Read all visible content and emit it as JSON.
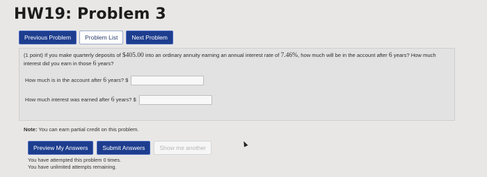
{
  "page": {
    "title": "HW19: Problem 3"
  },
  "nav": {
    "previous": "Previous Problem",
    "list": "Problem List",
    "next": "Next Problem"
  },
  "problem": {
    "points": "(1 point)",
    "text_a": "If you make quarterly deposits of",
    "deposit": "$405.00",
    "text_b": "into an ordinary annuity earning an annual interest rate of",
    "rate": "7.46%",
    "text_c": ", how much will be in the account after",
    "years1": "6",
    "text_d": "years? How much interest did you earn in those",
    "years2": "6",
    "text_e": "years?",
    "q1_a": "How much is in the account after",
    "q1_years": "6",
    "q1_b": "years? $",
    "q1_value": "",
    "q2_a": "How much interest was earned after",
    "q2_years": "6",
    "q2_b": "years? $",
    "q2_value": ""
  },
  "note": {
    "label": "Note:",
    "text": "You can earn partial credit on this problem."
  },
  "actions": {
    "preview": "Preview My Answers",
    "submit": "Submit Answers",
    "show_another": "Show me another"
  },
  "status": {
    "attempts_a": "You have attempted this problem",
    "attempts_count": "0",
    "attempts_b": "times.",
    "remaining": "You have unlimited attempts remaining."
  },
  "colors": {
    "primary_button": "#1d3d8e",
    "background": "#e8e7e6"
  }
}
